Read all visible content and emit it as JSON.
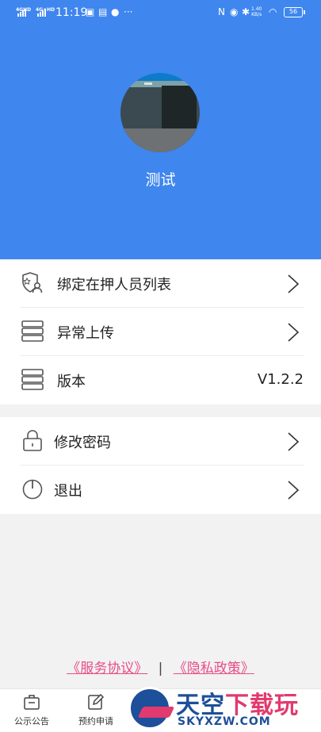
{
  "status_bar": {
    "net1": "4GHD",
    "net2": "4G+HD",
    "time": "11:19",
    "rate": "1.40\nKB/s",
    "battery": "56"
  },
  "profile": {
    "username": "测试"
  },
  "menu": {
    "bind_list": "绑定在押人员列表",
    "upload_errors": "异常上传",
    "version_label": "版本",
    "version_value": "V1.2.2",
    "change_password": "修改密码",
    "logout": "退出"
  },
  "footer": {
    "service_agreement": "《服务协议》",
    "separator": "|",
    "privacy_policy": "《隐私政策》"
  },
  "tabs": [
    {
      "label": "公示公告",
      "icon": "briefcase-icon"
    },
    {
      "label": "预约申请",
      "icon": "edit-icon"
    }
  ],
  "watermark": {
    "title_left": "天空",
    "title_right": "下载玩",
    "subtitle": "SKYXZW.COM"
  },
  "colors": {
    "header_blue": "#3f86ee",
    "link_pink": "#e84d88"
  }
}
